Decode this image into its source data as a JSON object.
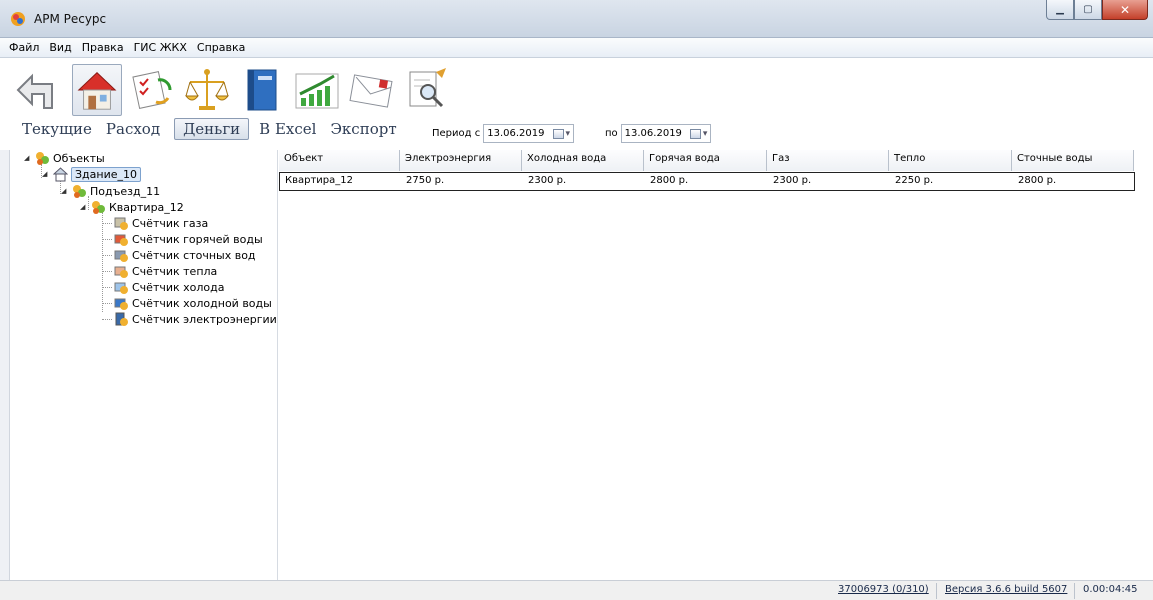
{
  "window": {
    "title": "АРМ Ресурс"
  },
  "menu": [
    "Файл",
    "Вид",
    "Правка",
    "ГИС ЖКХ",
    "Справка"
  ],
  "toolbar": {
    "icons": [
      "back-arrow-icon",
      "house-meter-icon",
      "checklist-exchange-icon",
      "scales-icon",
      "book-icon",
      "chart-growth-icon",
      "envelope-icon",
      "document-magnifier-icon"
    ],
    "text_buttons": [
      "Текущие",
      "Расход",
      "Деньги",
      "В Excel",
      "Экспорт"
    ],
    "active_text_button": "Деньги",
    "period_from_label": "Период с",
    "period_from_value": "13.06.2019",
    "period_to_label": "по",
    "period_to_value": "13.06.2019"
  },
  "tree": {
    "root": "Объекты",
    "building": "Здание_10",
    "entrance": "Подъезд_11",
    "apartment": "Квартира_12",
    "meters": [
      "Счётчик газа",
      "Счётчик горячей воды",
      "Счётчик сточных вод",
      "Счётчик тепла",
      "Счётчик холода",
      "Счётчик холодной воды",
      "Счётчик электроэнергии"
    ]
  },
  "table": {
    "columns": [
      "Объект",
      "Электроэнергия",
      "Холодная вода",
      "Горячая вода",
      "Газ",
      "Тепло",
      "Сточные воды"
    ],
    "rows": [
      [
        "Квартира_12",
        "2750 р.",
        "2300 р.",
        "2800 р.",
        "2300 р.",
        "2250 р.",
        "2800 р."
      ]
    ]
  },
  "status": {
    "counter": "37006973 (0/310)",
    "version": "Версия 3.6.6 build 5607",
    "elapsed": "0.00:04:45"
  }
}
